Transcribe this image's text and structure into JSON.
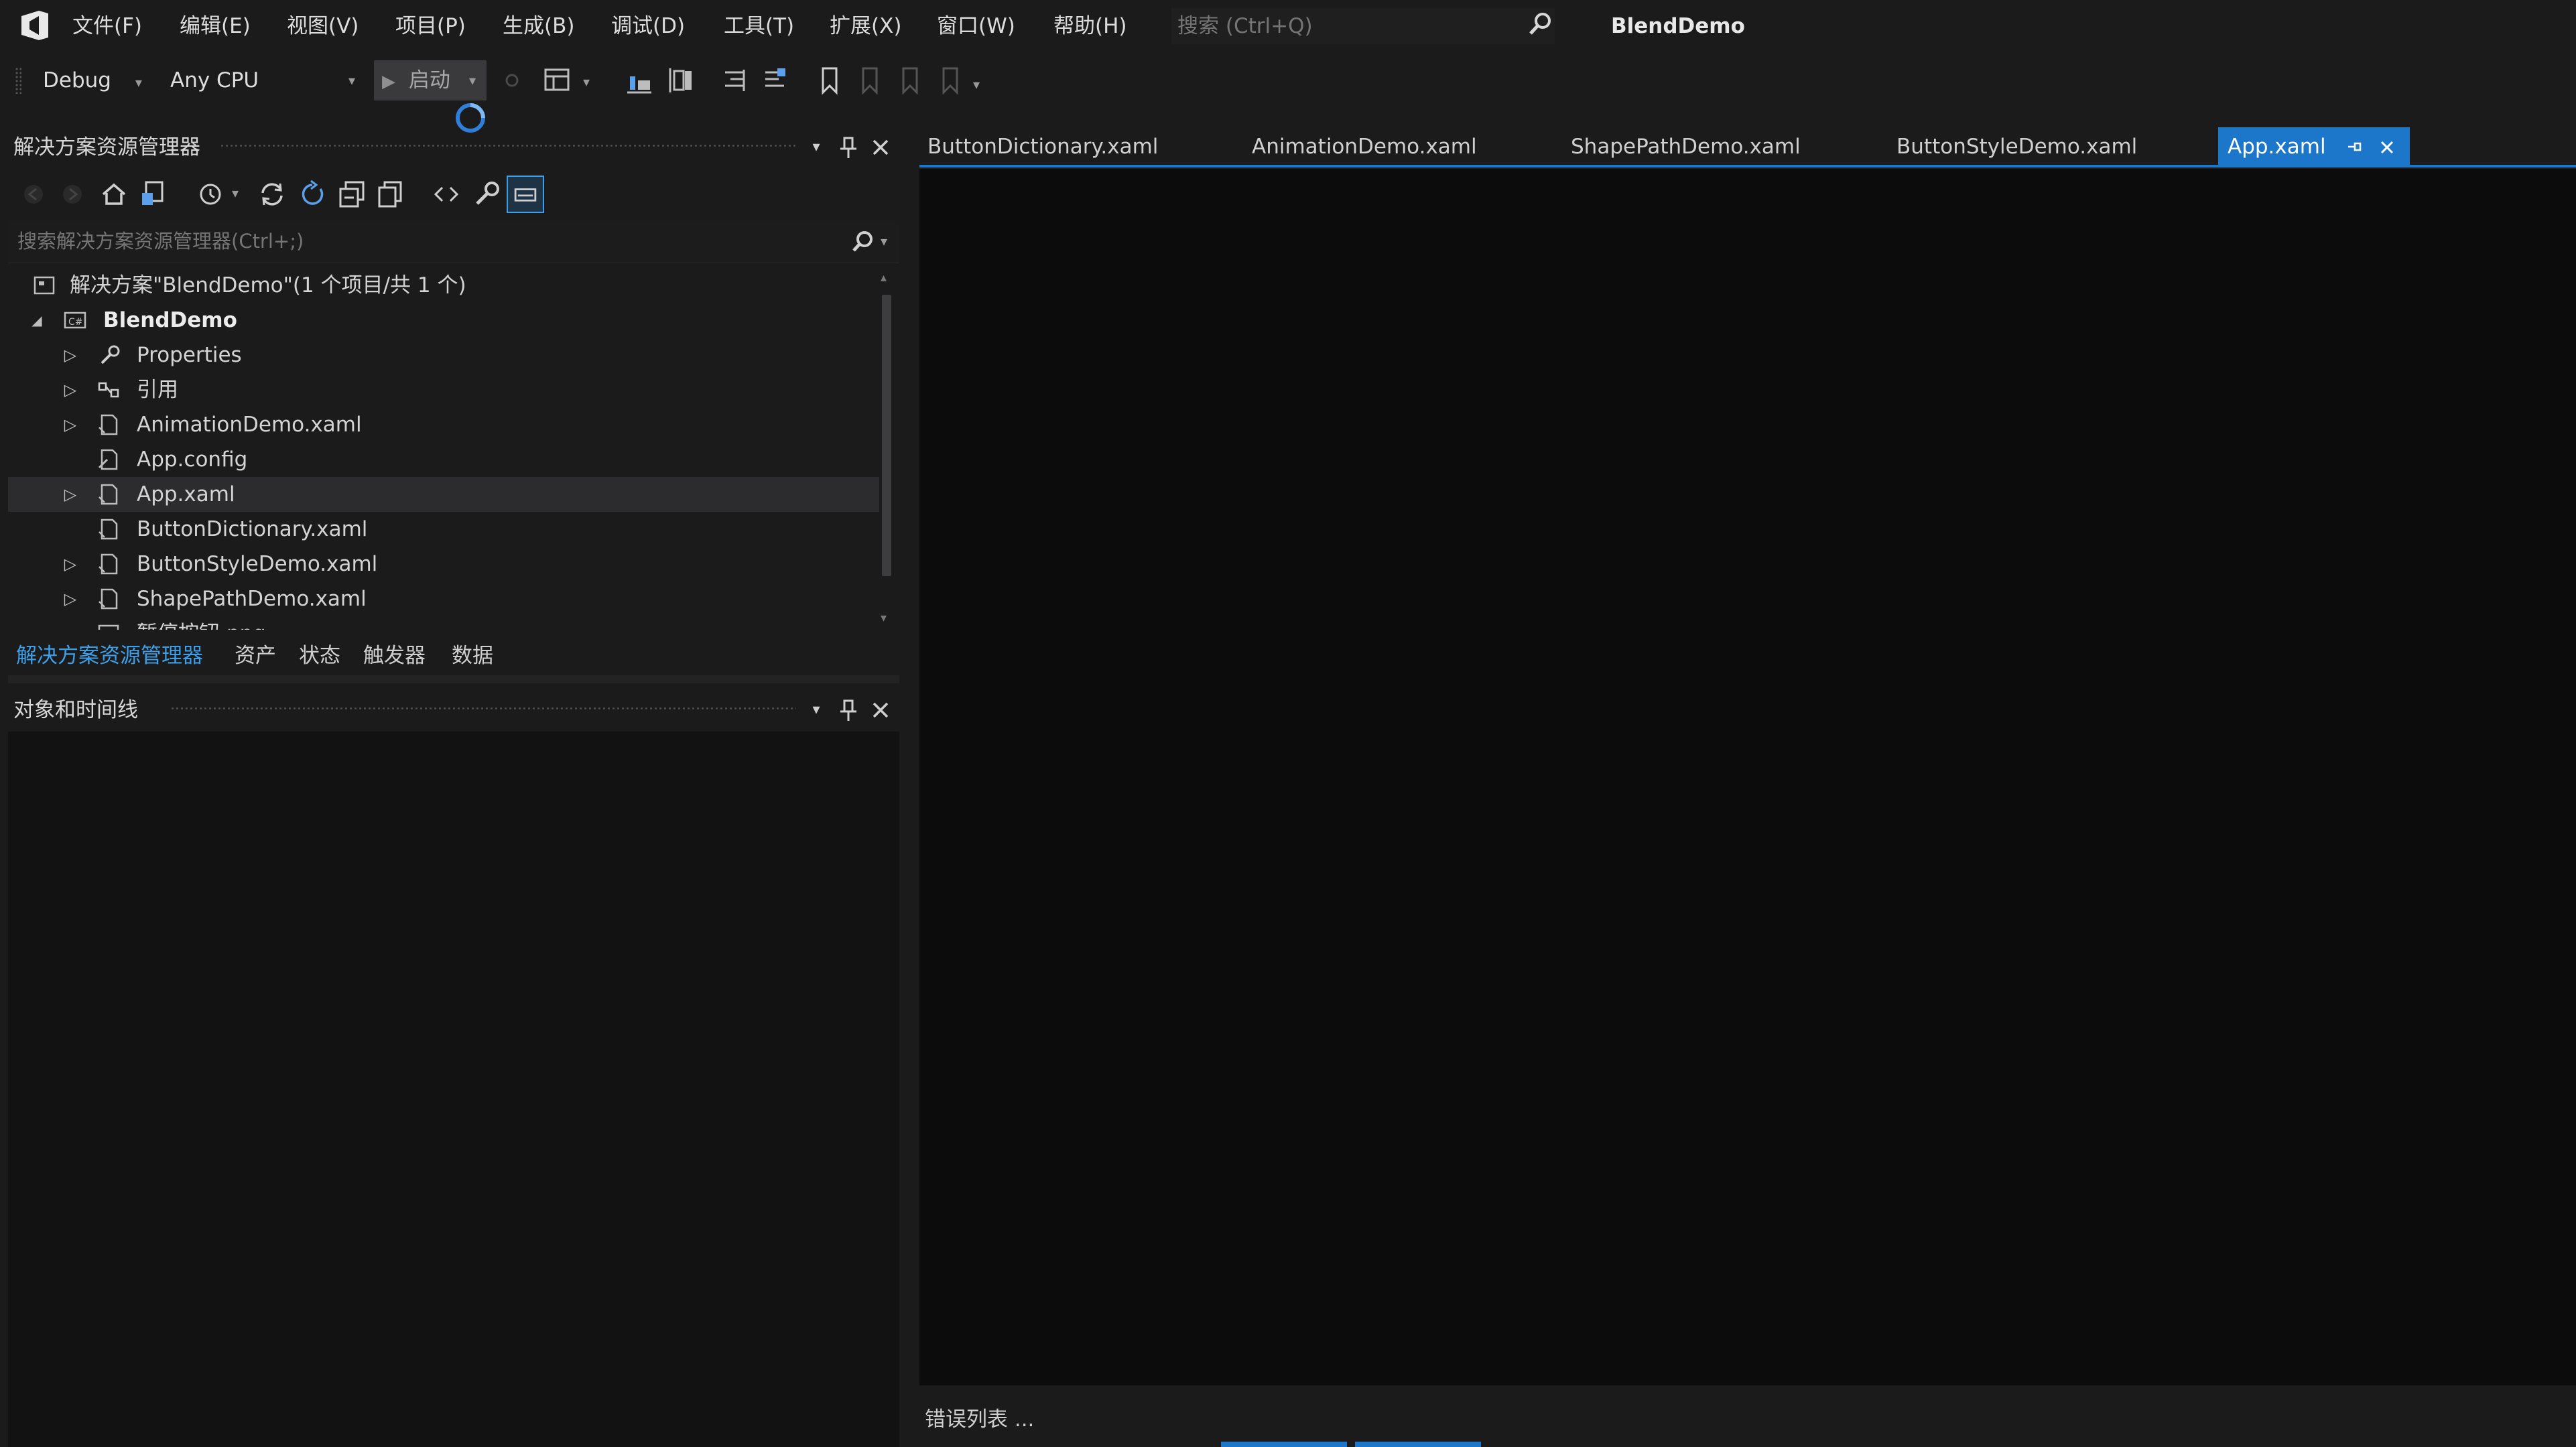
{
  "app": {
    "window_title": "BlendDemo",
    "menu": [
      "文件(F)",
      "编辑(E)",
      "视图(V)",
      "项目(P)",
      "生成(B)",
      "调试(D)",
      "工具(T)",
      "扩展(X)",
      "窗口(W)",
      "帮助(H)"
    ],
    "search_placeholder": "搜索 (Ctrl+Q)"
  },
  "toolbar": {
    "configuration": "Debug",
    "platform": "Any CPU",
    "start_label": "启动"
  },
  "solution_explorer": {
    "title": "解决方案资源管理器",
    "search_placeholder": "搜索解决方案资源管理器(Ctrl+;)",
    "solution_label": "解决方案\"BlendDemo\"(1 个项目/共 1 个)",
    "project_label": "BlendDemo",
    "items": [
      {
        "label": "Properties",
        "icon": "wrench-icon",
        "expandable": true
      },
      {
        "label": "引用",
        "icon": "references-icon",
        "expandable": true
      },
      {
        "label": "AnimationDemo.xaml",
        "icon": "xaml-file-icon",
        "expandable": true
      },
      {
        "label": "App.config",
        "icon": "config-file-icon",
        "expandable": false
      },
      {
        "label": "App.xaml",
        "icon": "xaml-file-icon",
        "expandable": true,
        "selected": true
      },
      {
        "label": "ButtonDictionary.xaml",
        "icon": "xaml-file-icon",
        "expandable": false
      },
      {
        "label": "ButtonStyleDemo.xaml",
        "icon": "xaml-file-icon",
        "expandable": true
      },
      {
        "label": "ShapePathDemo.xaml",
        "icon": "xaml-file-icon",
        "expandable": true
      },
      {
        "label": "暂停按钮.png",
        "icon": "image-file-icon",
        "expandable": false
      }
    ],
    "bottom_tabs": [
      "解决方案资源管理器",
      "资产",
      "状态",
      "触发器",
      "数据"
    ]
  },
  "objects_panel": {
    "title": "对象和时间线"
  },
  "editor": {
    "tabs": [
      "ButtonDictionary.xaml",
      "AnimationDemo.xaml",
      "ShapePathDemo.xaml",
      "ButtonStyleDemo.xaml"
    ],
    "active_tab": "App.xaml"
  },
  "bottom_panel": {
    "title": "错误列表 ..."
  },
  "colors": {
    "accent": "#1c76c9",
    "background": "#1b1b1c",
    "editor_background": "#0c0c0c",
    "active_bottom_tab": "#3c9fe8"
  }
}
